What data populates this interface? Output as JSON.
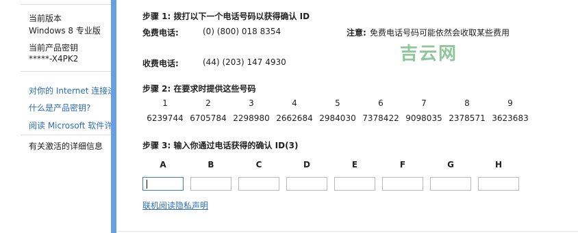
{
  "sidebar": {
    "version_label": "当前版本",
    "version_value": "Windows 8 专业版",
    "key_label": "当前产品密钥",
    "key_value": "*****-X4PK2",
    "links": [
      "对你的 Internet 连接进",
      "什么是产品密钥?",
      "阅读 Microsoft 软件许"
    ],
    "details": "有关激活的详细信息"
  },
  "step1": {
    "title": "步骤 1: 拨打以下一个电话号码以获得确认 ID",
    "free_label": "免费电话:",
    "free_number": "(0) (800) 018 8354",
    "note_label": "注意:",
    "note_text": "免费电话号码可能依然会收取某些费用",
    "toll_label": "收费电话:",
    "toll_number": "(44) (203) 147 4930"
  },
  "watermark": "吉云网",
  "step2": {
    "title": "步骤 2: 在要求时提供这些号码",
    "indices": [
      "1",
      "2",
      "3",
      "4",
      "5",
      "6",
      "7",
      "8",
      "9"
    ],
    "groups": [
      "6239744",
      "6705784",
      "2298980",
      "2662684",
      "2984030",
      "7378422",
      "9098035",
      "2378571",
      "3623683"
    ]
  },
  "step3": {
    "title": "步骤 3: 输入你通过电话获得的确认 ID(3)",
    "columns": [
      "A",
      "B",
      "C",
      "D",
      "E",
      "F",
      "G",
      "H"
    ],
    "inputs": [
      "",
      "",
      "",
      "",
      "",
      "",
      "",
      ""
    ]
  },
  "privacy_link": "联机阅读隐私声明",
  "colors": {
    "accent": "#6a9fdd",
    "link": "#2a6ebb",
    "watermark": "#8ec79a"
  }
}
